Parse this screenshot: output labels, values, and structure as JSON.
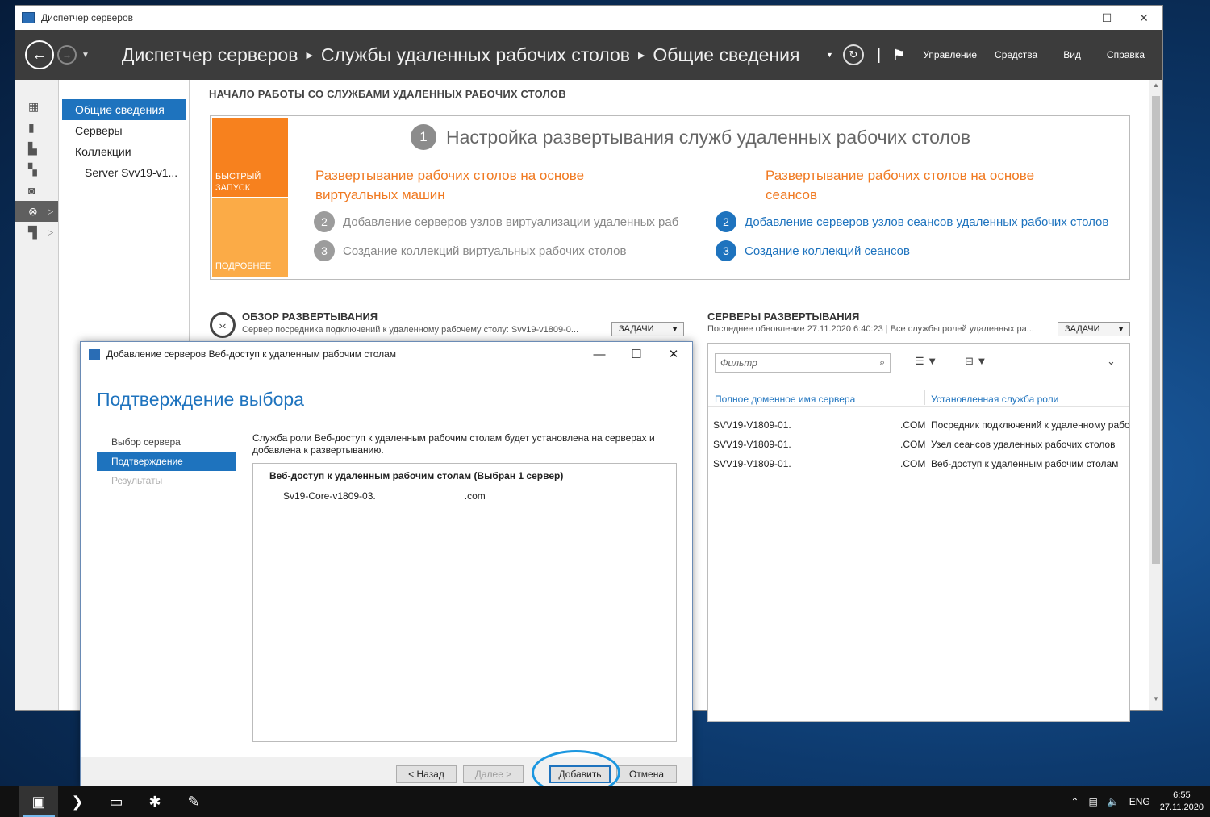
{
  "window": {
    "title": "Диспетчер серверов",
    "minimize": "—",
    "maximize": "☐",
    "close": "✕"
  },
  "header": {
    "breadcrumb": [
      "Диспетчер серверов",
      "Службы удаленных рабочих столов",
      "Общие сведения"
    ],
    "menu": [
      "Управление",
      "Средства",
      "Вид",
      "Справка"
    ]
  },
  "nav": {
    "items": [
      "Общие сведения",
      "Серверы",
      "Коллекции"
    ],
    "sub_item": "Server Svv19-v1..."
  },
  "quickstart": {
    "section_title": "НАЧАЛО РАБОТЫ СО СЛУЖБАМИ УДАЛЕННЫХ РАБОЧИХ СТОЛОВ",
    "tile_quick": "БЫСТРЫЙ ЗАПУСК",
    "tile_more": "ПОДРОБНЕЕ",
    "step1_num": "1",
    "step1_text": "Настройка развертывания служб удаленных рабочих столов",
    "left_col_head": "Развертывание рабочих столов на основе виртуальных машин",
    "left_steps": [
      {
        "num": "2",
        "text": "Добавление серверов узлов виртуализации удаленных раб"
      },
      {
        "num": "3",
        "text": "Создание коллекций виртуальных рабочих столов"
      }
    ],
    "right_col_head": "Развертывание рабочих столов на основе сеансов",
    "right_steps": [
      {
        "num": "2",
        "text": "Добавление серверов узлов сеансов удаленных рабочих столов"
      },
      {
        "num": "3",
        "text": "Создание коллекций сеансов"
      }
    ]
  },
  "overview": {
    "title": "ОБЗОР РАЗВЕРТЫВАНИЯ",
    "subtitle": "Сервер посредника подключений к удаленному рабочему столу: Svv19-v1809-0...",
    "tasks": "ЗАДАЧИ"
  },
  "servers": {
    "title": "СЕРВЕРЫ РАЗВЕРТЫВАНИЯ",
    "subtitle": "Последнее обновление 27.11.2020 6:40:23 | Все службы ролей удаленных ра...",
    "tasks": "ЗАДАЧИ",
    "filter_placeholder": "Фильтр",
    "col_fqdn": "Полное доменное имя сервера",
    "col_role": "Установленная служба роли",
    "rows": [
      {
        "name": "SVV19-V1809-01.",
        "domain": ".COM",
        "role": "Посредник подключений к удаленному рабо"
      },
      {
        "name": "SVV19-V1809-01.",
        "domain": ".COM",
        "role": "Узел сеансов удаленных рабочих столов"
      },
      {
        "name": "SVV19-V1809-01.",
        "domain": ".COM",
        "role": "Веб-доступ к удаленным рабочим столам"
      }
    ]
  },
  "wizard": {
    "title": "Добавление серверов Веб-доступ к удаленным рабочим столам",
    "heading": "Подтверждение выбора",
    "steps": [
      "Выбор сервера",
      "Подтверждение",
      "Результаты"
    ],
    "description": "Служба роли Веб-доступ к удаленным рабочим столам будет установлена на серверах и добавлена к развертыванию.",
    "role_line": "Веб-доступ к удаленным рабочим столам  (Выбран 1 сервер)",
    "server_name": "Sv19-Core-v1809-03.",
    "server_suffix": ".com",
    "btn_back": "< Назад",
    "btn_next": "Далее >",
    "btn_add": "Добавить",
    "btn_cancel": "Отмена"
  },
  "taskbar": {
    "lang": "ENG",
    "time": "6:55",
    "date": "27.11.2020"
  },
  "colors": {
    "accent": "#1e73be",
    "orange": "#f7811e",
    "orange_light": "#fbab47",
    "highlight": "#1c97e0"
  }
}
